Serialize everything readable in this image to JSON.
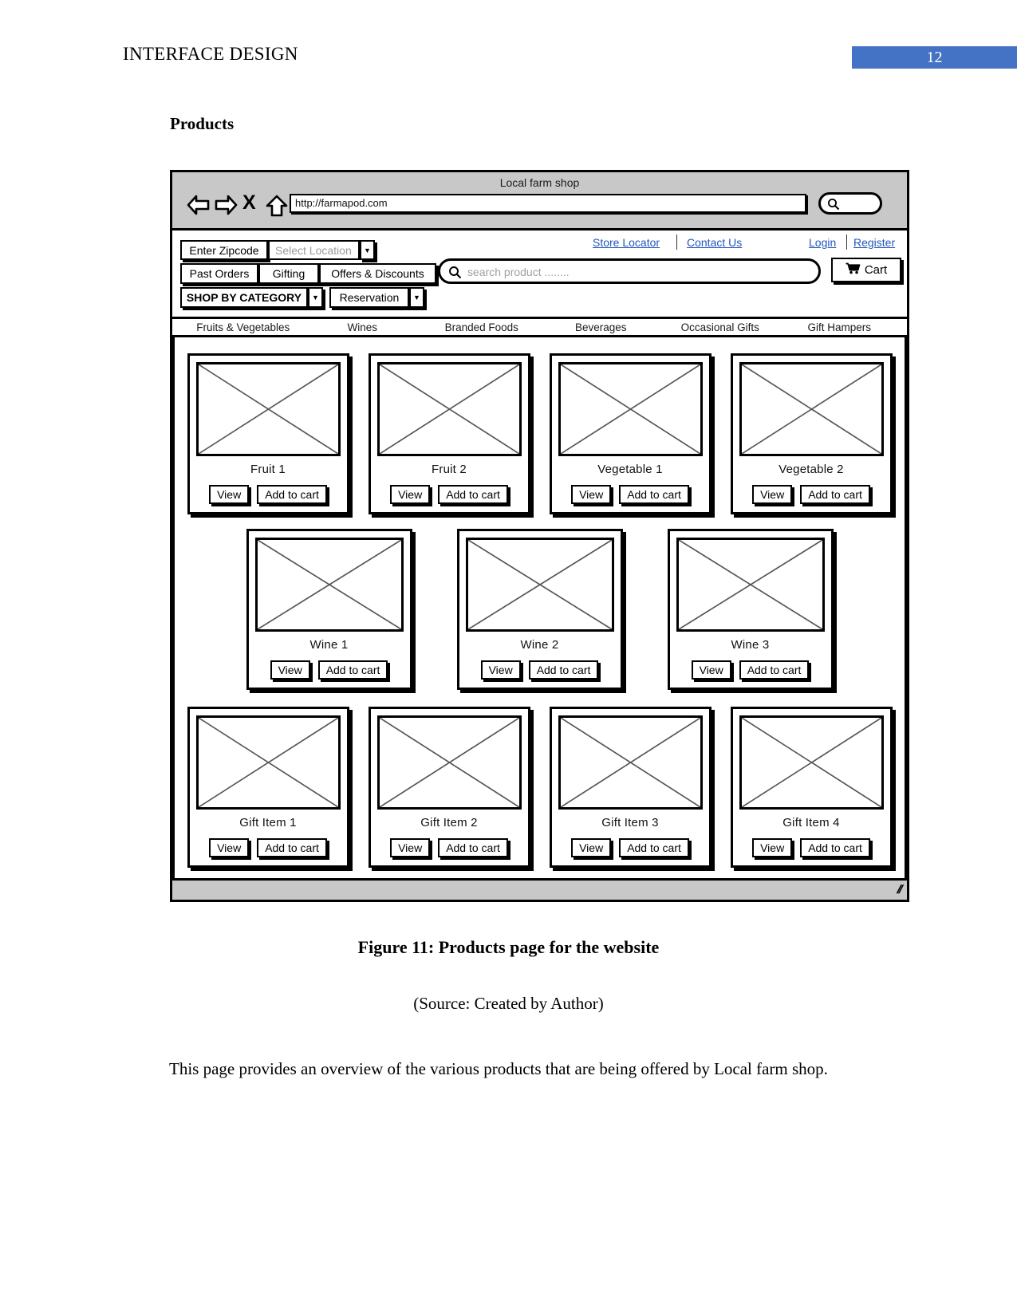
{
  "document": {
    "header_title": "INTERFACE DESIGN",
    "page_number": "12",
    "section_heading": "Products",
    "figure_caption": "Figure 11: Products page for the website",
    "figure_source": "(Source: Created by Author)",
    "body_paragraph": "This page provides an overview of the various products that are being offered by Local farm shop."
  },
  "browser": {
    "title": "Local farm shop",
    "url": "http://farmapod.com",
    "back_icon": "back-arrow-icon",
    "forward_icon": "forward-arrow-icon",
    "stop_icon": "×",
    "stop_label": "X",
    "home_icon": "home-icon",
    "search_icon": "search-icon",
    "resize_handle": "//"
  },
  "site_header": {
    "zipcode_button": "Enter Zipcode",
    "location_select_value": "Select Location",
    "past_orders": "Past Orders",
    "gifting": "Gifting",
    "offers_discounts": "Offers & Discounts",
    "shop_by_category": "SHOP BY CATEGORY",
    "reservation": "Reservation",
    "dropdown_glyph": "▼",
    "search_placeholder": "search product ........",
    "cart_label": "Cart",
    "links": [
      {
        "label": "Store Locator"
      },
      {
        "label": "Contact Us"
      },
      {
        "label": "Login"
      },
      {
        "label": "Register"
      }
    ]
  },
  "category_tabs": [
    {
      "label": "Fruits & Vegetables"
    },
    {
      "label": "Wines"
    },
    {
      "label": "Branded Foods"
    },
    {
      "label": "Beverages"
    },
    {
      "label": "Occasional Gifts"
    },
    {
      "label": "Gift Hampers"
    }
  ],
  "product_buttons": {
    "view": "View",
    "add_to_cart": "Add to cart"
  },
  "product_rows": [
    {
      "columns": 4,
      "items": [
        {
          "name": "Fruit 1"
        },
        {
          "name": "Fruit 2"
        },
        {
          "name": "Vegetable 1"
        },
        {
          "name": "Vegetable 2"
        }
      ]
    },
    {
      "columns": 3,
      "items": [
        {
          "name": "Wine 1"
        },
        {
          "name": "Wine 2"
        },
        {
          "name": "Wine 3"
        }
      ]
    },
    {
      "columns": 4,
      "items": [
        {
          "name": "Gift Item 1"
        },
        {
          "name": "Gift Item 2"
        },
        {
          "name": "Gift Item 3"
        },
        {
          "name": "Gift Item 4"
        }
      ]
    }
  ],
  "colors": {
    "page_number_band": "#4472C4",
    "link": "#2255bb",
    "chrome": "#c8c8c8",
    "placeholder": "#a0a0a0"
  }
}
